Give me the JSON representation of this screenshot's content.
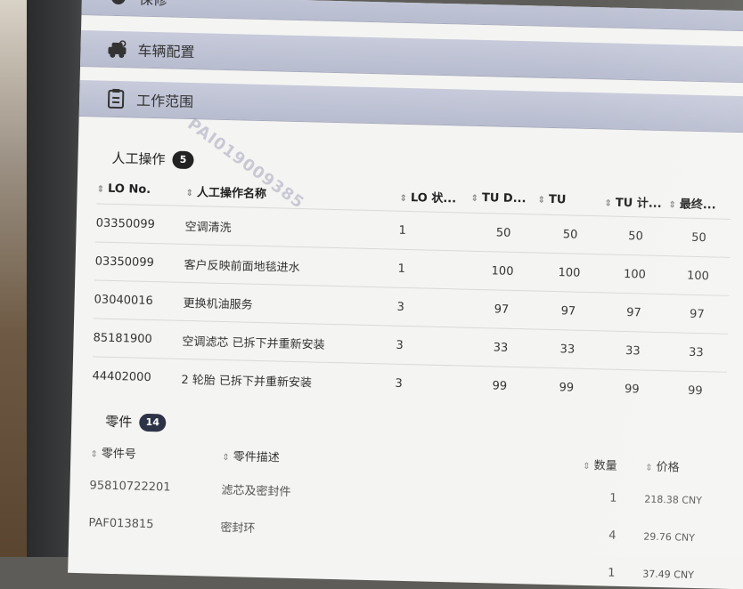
{
  "panels": {
    "top_partial": "保修",
    "vehicle_config": "车辆配置",
    "work_scope": "工作范围"
  },
  "labor": {
    "title": "人工操作",
    "count": "5",
    "headers": [
      "LO No.",
      "人工操作名称",
      "LO 状...",
      "TU D...",
      "TU",
      "TU 计...",
      "最终..."
    ],
    "rows": [
      [
        "03350099",
        "空调清洗",
        "1",
        "50",
        "50",
        "50",
        "50"
      ],
      [
        "03350099",
        "客户反映前面地毯进水",
        "1",
        "100",
        "100",
        "100",
        "100"
      ],
      [
        "03040016",
        "更换机油服务",
        "3",
        "97",
        "97",
        "97",
        "97"
      ],
      [
        "85181900",
        "空调滤芯 已拆下并重新安装",
        "3",
        "33",
        "33",
        "33",
        "33"
      ],
      [
        "44402000",
        "2 轮胎 已拆下并重新安装",
        "3",
        "99",
        "99",
        "99",
        "99"
      ]
    ]
  },
  "parts": {
    "title": "零件",
    "count": "14",
    "headers": [
      "零件号",
      "零件描述",
      "数量",
      "价格"
    ],
    "rows": [
      [
        "95810722201",
        "滤芯及密封件",
        "1",
        "218.38 CNY"
      ],
      [
        "PAF013815",
        "密封环",
        "4",
        "29.76 CNY"
      ],
      [
        "",
        "",
        "1",
        "37.49 CNY"
      ]
    ]
  },
  "watermark": "PAI019009385"
}
